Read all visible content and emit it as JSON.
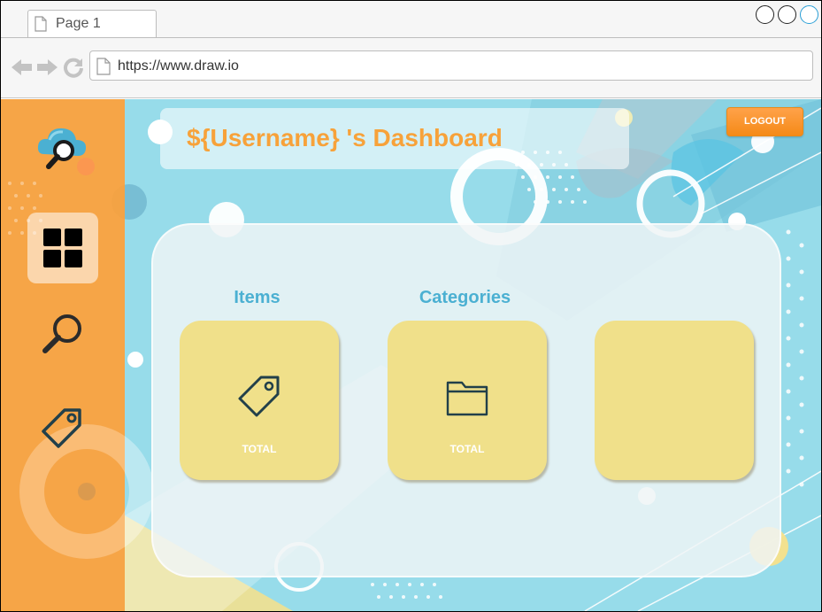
{
  "browser": {
    "tab_title": "Page 1",
    "url": "https://www.draw.io"
  },
  "header": {
    "title": "${Username} 's Dashboard",
    "logout_label": "LOGOUT"
  },
  "sidebar": {
    "items": [
      {
        "icon": "cloud-search-logo-icon"
      },
      {
        "icon": "dashboard-icon",
        "active": true
      },
      {
        "icon": "search-icon"
      },
      {
        "icon": "tag-icon"
      }
    ]
  },
  "cards": [
    {
      "label": "Items",
      "icon": "tag-icon",
      "total_label": "TOTAL"
    },
    {
      "label": "Categories",
      "icon": "folder-icon",
      "total_label": "TOTAL"
    },
    {
      "label": "",
      "icon": "",
      "total_label": ""
    }
  ],
  "colors": {
    "accent_orange": "#f7a23a",
    "sidebar": "#fda03a",
    "background_blue": "#97dcea",
    "card_yellow": "#f0e08a",
    "label_blue": "#4bb0d2"
  }
}
